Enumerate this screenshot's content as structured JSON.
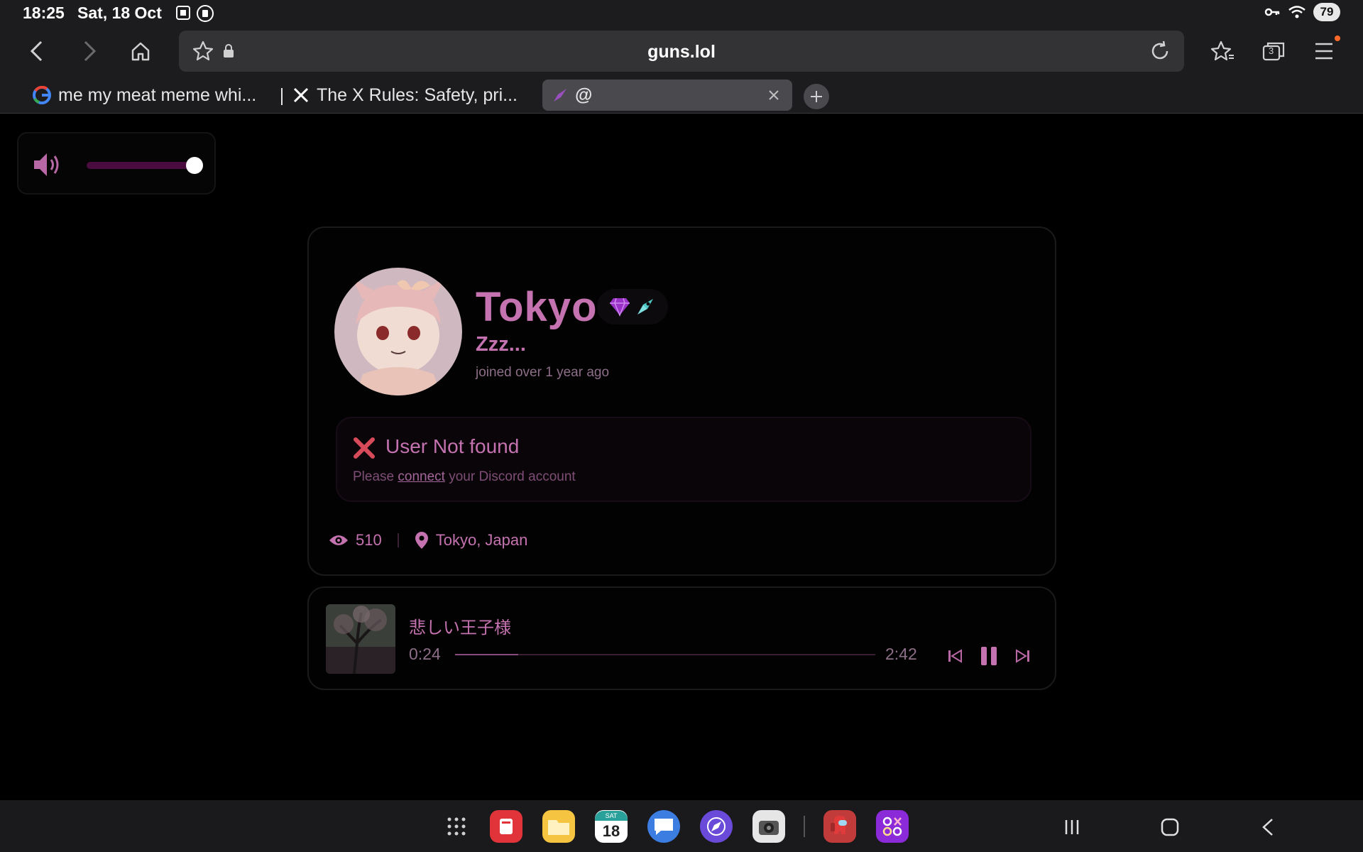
{
  "status_bar": {
    "time": "18:25",
    "date": "Sat, 18 Oct",
    "battery": "79"
  },
  "browser": {
    "url": "guns.lol",
    "tabs": [
      {
        "label": "me my meat meme whi...",
        "icon": "google-icon"
      },
      {
        "label": "The X Rules: Safety, pri...",
        "icon": "x-logo-icon"
      },
      {
        "label": "@",
        "icon": "guns-rocket-icon"
      }
    ],
    "tab_count": "3"
  },
  "profile": {
    "display_name": "Tokyo",
    "bio": "Zzz...",
    "joined": "joined over 1 year ago",
    "discord": {
      "title": "User Not found",
      "prefix": "Please",
      "link": "connect",
      "suffix": "your Discord account"
    },
    "views": "510",
    "location": "Tokyo, Japan"
  },
  "music": {
    "title": "悲しい王子様",
    "current_time": "0:24",
    "total_time": "2:42",
    "progress": 0.15
  },
  "volume": {
    "level": 1.0
  },
  "colors": {
    "accent": "#c472b0",
    "muted": "#8d6e88",
    "background": "#000000",
    "volume_track": "#4a0b3e"
  },
  "dock": {
    "calendar_day": "18",
    "calendar_weekday": "SAT"
  }
}
